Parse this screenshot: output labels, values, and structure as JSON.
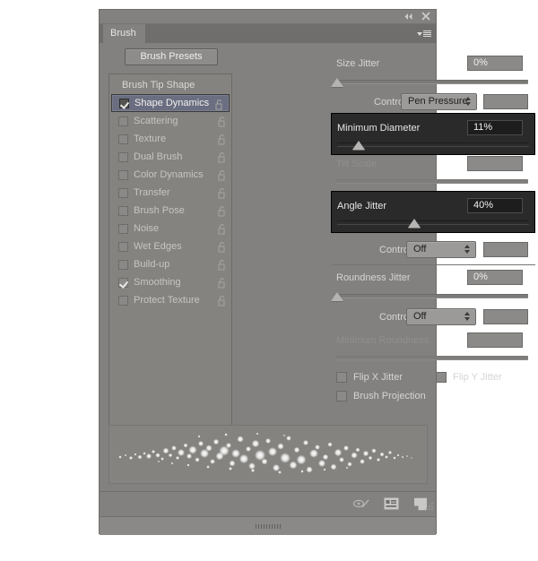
{
  "window": {
    "title": "Brush",
    "collapse_icon": "collapse-double-arrow-icon",
    "close_icon": "close-icon",
    "panel_menu_icon": "panel-menu-icon"
  },
  "left": {
    "presets_button": "Brush Presets",
    "list_header": "Brush Tip Shape",
    "items": [
      {
        "label": "Shape Dynamics",
        "checked": true,
        "selected": true
      },
      {
        "label": "Scattering",
        "checked": false,
        "selected": false
      },
      {
        "label": "Texture",
        "checked": false,
        "selected": false
      },
      {
        "label": "Dual Brush",
        "checked": false,
        "selected": false
      },
      {
        "label": "Color Dynamics",
        "checked": false,
        "selected": false
      },
      {
        "label": "Transfer",
        "checked": false,
        "selected": false
      },
      {
        "label": "Brush Pose",
        "checked": false,
        "selected": false
      },
      {
        "label": "Noise",
        "checked": false,
        "selected": false
      },
      {
        "label": "Wet Edges",
        "checked": false,
        "selected": false
      },
      {
        "label": "Build-up",
        "checked": false,
        "selected": false
      },
      {
        "label": "Smoothing",
        "checked": true,
        "selected": false
      },
      {
        "label": "Protect Texture",
        "checked": false,
        "selected": false
      }
    ],
    "lock_icon": "lock-open-icon"
  },
  "right": {
    "size_jitter": {
      "label": "Size Jitter",
      "value": "0%",
      "slider_pct": 0
    },
    "size_control": {
      "label": "Control:",
      "value": "Pen Pressure"
    },
    "minimum_diameter": {
      "label": "Minimum Diameter",
      "value": "11%",
      "slider_pct": 11,
      "highlighted": true
    },
    "tilt_scale": {
      "label": "Tilt Scale",
      "value": "",
      "slider_pct": 0,
      "disabled": true
    },
    "angle_jitter": {
      "label": "Angle Jitter",
      "value": "40%",
      "slider_pct": 40,
      "highlighted": true
    },
    "angle_control": {
      "label": "Control:",
      "value": "Off"
    },
    "roundness_jitter": {
      "label": "Roundness Jitter",
      "value": "0%",
      "slider_pct": 0
    },
    "roundness_control": {
      "label": "Control:",
      "value": "Off"
    },
    "minimum_roundness": {
      "label": "Minimum Roundness",
      "value": "",
      "slider_pct": 0,
      "disabled": true
    },
    "flip_x": {
      "label": "Flip X Jitter",
      "checked": false
    },
    "flip_y": {
      "label": "Flip Y Jitter",
      "checked": false
    },
    "brush_projection": {
      "label": "Brush Projection",
      "checked": false
    }
  },
  "bottom": {
    "icons": [
      "toggle-brush-painting-icon",
      "new-brush-preset-icon",
      "create-new-brush-icon"
    ]
  },
  "colors": {
    "panel_bg": "#82817f",
    "list_bg": "#84837f",
    "selected_row": "#6a6e80",
    "highlight_box": "#2a2a2a",
    "text": "#d6d5d3",
    "text_dim": "#908f8d"
  }
}
